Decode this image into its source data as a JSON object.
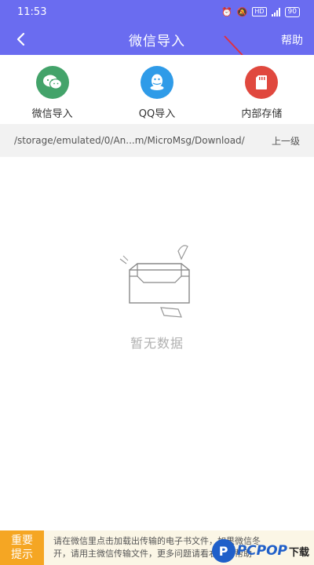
{
  "status_bar": {
    "time": "11:53",
    "net_tag": "HD",
    "battery": "90"
  },
  "app_bar": {
    "title": "微信导入",
    "help_label": "帮助"
  },
  "tabs": [
    {
      "label": "微信导入",
      "icon": "wechat-icon",
      "color": "#43a36a"
    },
    {
      "label": "QQ导入",
      "icon": "qq-icon",
      "color": "#2f9be8"
    },
    {
      "label": "内部存储",
      "icon": "sd-card-icon",
      "color": "#e0483e"
    }
  ],
  "path_bar": {
    "path": "/storage/emulated/0/An...m/MicroMsg/Download/",
    "up_label": "上一级"
  },
  "empty_state": {
    "text": "暂无数据"
  },
  "notice": {
    "badge_line1": "重要",
    "badge_line2": "提示",
    "line1": "请在微信里点击加载出传输的电子书文件，如果微信冬",
    "line2": "开，请用主微信传输文件，更多问题请看右上角帮助"
  },
  "watermark": {
    "logo": "P",
    "brand": "PCPOP",
    "suffix": "下载"
  },
  "colors": {
    "primary": "#6a6cf0",
    "badge": "#f5a623",
    "annotation": "#e03040"
  }
}
